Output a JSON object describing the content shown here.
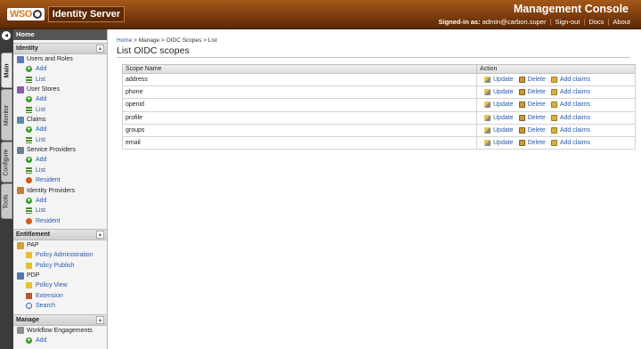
{
  "header": {
    "logo_text": "WSO",
    "product": "Identity Server",
    "console_title": "Management Console",
    "signed_in_label": "Signed-in as:",
    "signed_in_user": "admin@carbon.super",
    "links": [
      "Sign-out",
      "Docs",
      "About"
    ]
  },
  "vtabs": [
    "Main",
    "Monitor",
    "Configure",
    "Tools"
  ],
  "sidebar": {
    "home": "Home",
    "sections": [
      {
        "title": "Identity"
      },
      {
        "title": "Entitlement"
      },
      {
        "title": "Manage"
      }
    ],
    "identity_groups": [
      {
        "label": "Users and Roles",
        "items": [
          "Add",
          "List"
        ]
      },
      {
        "label": "User Stores",
        "items": [
          "Add",
          "List"
        ]
      },
      {
        "label": "Claims",
        "items": [
          "Add",
          "List"
        ]
      },
      {
        "label": "Service Providers",
        "items": [
          "Add",
          "List",
          "Resident"
        ]
      },
      {
        "label": "Identity Providers",
        "items": [
          "Add",
          "List",
          "Resident"
        ]
      }
    ],
    "entitlement_groups": [
      {
        "label": "PAP",
        "items": [
          "Policy Administration",
          "Policy Publish"
        ]
      },
      {
        "label": "PDP",
        "items": [
          "Policy View",
          "Extension",
          "Search"
        ]
      }
    ],
    "manage_groups": [
      {
        "label": "Workflow Engagements",
        "items": [
          "Add"
        ]
      }
    ]
  },
  "breadcrumb": {
    "home": "Home",
    "rest": "> Manage > OIDC Scopes > List"
  },
  "page_title": "List OIDC scopes",
  "table": {
    "columns": [
      "Scope Name",
      "Action"
    ],
    "rows": [
      "address",
      "phone",
      "openid",
      "profile",
      "groups",
      "email"
    ],
    "actions": {
      "update": "Update",
      "delete": "Delete",
      "add_claims": "Add claims"
    }
  },
  "colors": {
    "header": "#7a3a0c",
    "link": "#2a5aa8",
    "sidebar_dark": "#3b3b3b"
  }
}
